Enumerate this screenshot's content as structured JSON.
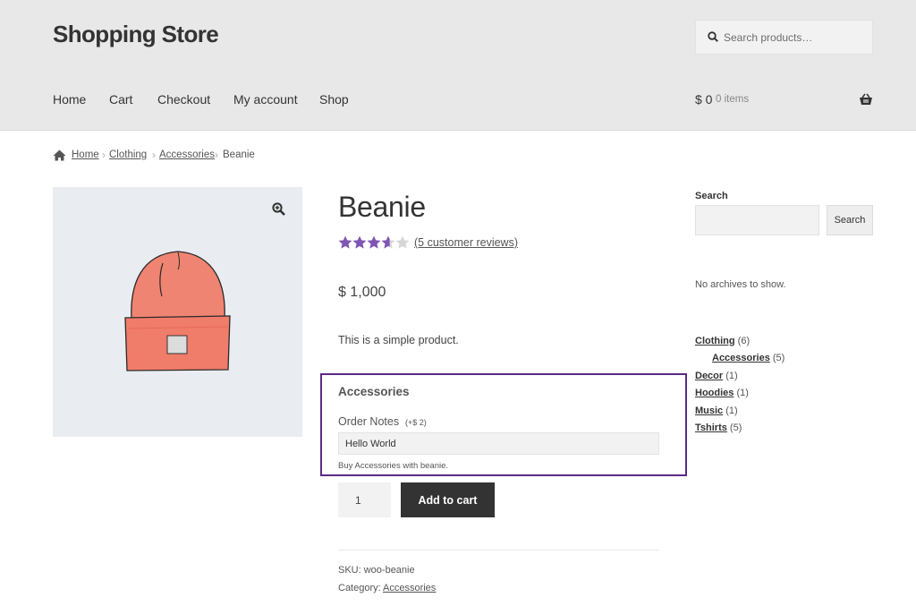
{
  "header": {
    "site_title": "Shopping Store",
    "search_placeholder": "Search products…",
    "nav": [
      "Home",
      "Cart",
      "Checkout",
      "My account",
      "Shop"
    ],
    "cart_total": "$ 0",
    "cart_items": "0 items"
  },
  "breadcrumb": {
    "items": [
      "Home",
      "Clothing",
      "Accessories"
    ],
    "current": "Beanie",
    "separator": "›"
  },
  "product": {
    "title": "Beanie",
    "rating": 3.6,
    "rating_max": 5,
    "reviews_link": "(5 customer reviews)",
    "price": "$ 1,000",
    "short_description": "This is a simple product.",
    "addon": {
      "heading": "Accessories",
      "field_label": "Order Notes",
      "field_price": "(+$ 2)",
      "field_value": "Hello World",
      "help_text": "Buy Accessories with beanie."
    },
    "quantity": "1",
    "add_to_cart_label": "Add to cart",
    "sku_text": "SKU: woo-beanie",
    "category_label": "Category:",
    "category_link": "Accessories"
  },
  "sidebar": {
    "search_title": "Search",
    "search_button": "Search",
    "no_archives": "No archives to show.",
    "categories": [
      {
        "name": "Clothing",
        "count": "(6)",
        "indent": false
      },
      {
        "name": "Accessories",
        "count": "(5)",
        "indent": true
      },
      {
        "name": "Decor",
        "count": "(1)",
        "indent": false
      },
      {
        "name": "Hoodies",
        "count": "(1)",
        "indent": false
      },
      {
        "name": "Music",
        "count": "(1)",
        "indent": false
      },
      {
        "name": "Tshirts",
        "count": "(5)",
        "indent": false
      }
    ]
  },
  "colors": {
    "header_bg": "#e8e8e8",
    "star": "#7f54b3",
    "addon_border": "#5b2a86",
    "button_bg": "#333333"
  },
  "icons": [
    "search-icon",
    "basket-icon",
    "home-icon",
    "zoom-icon",
    "star-icon"
  ]
}
